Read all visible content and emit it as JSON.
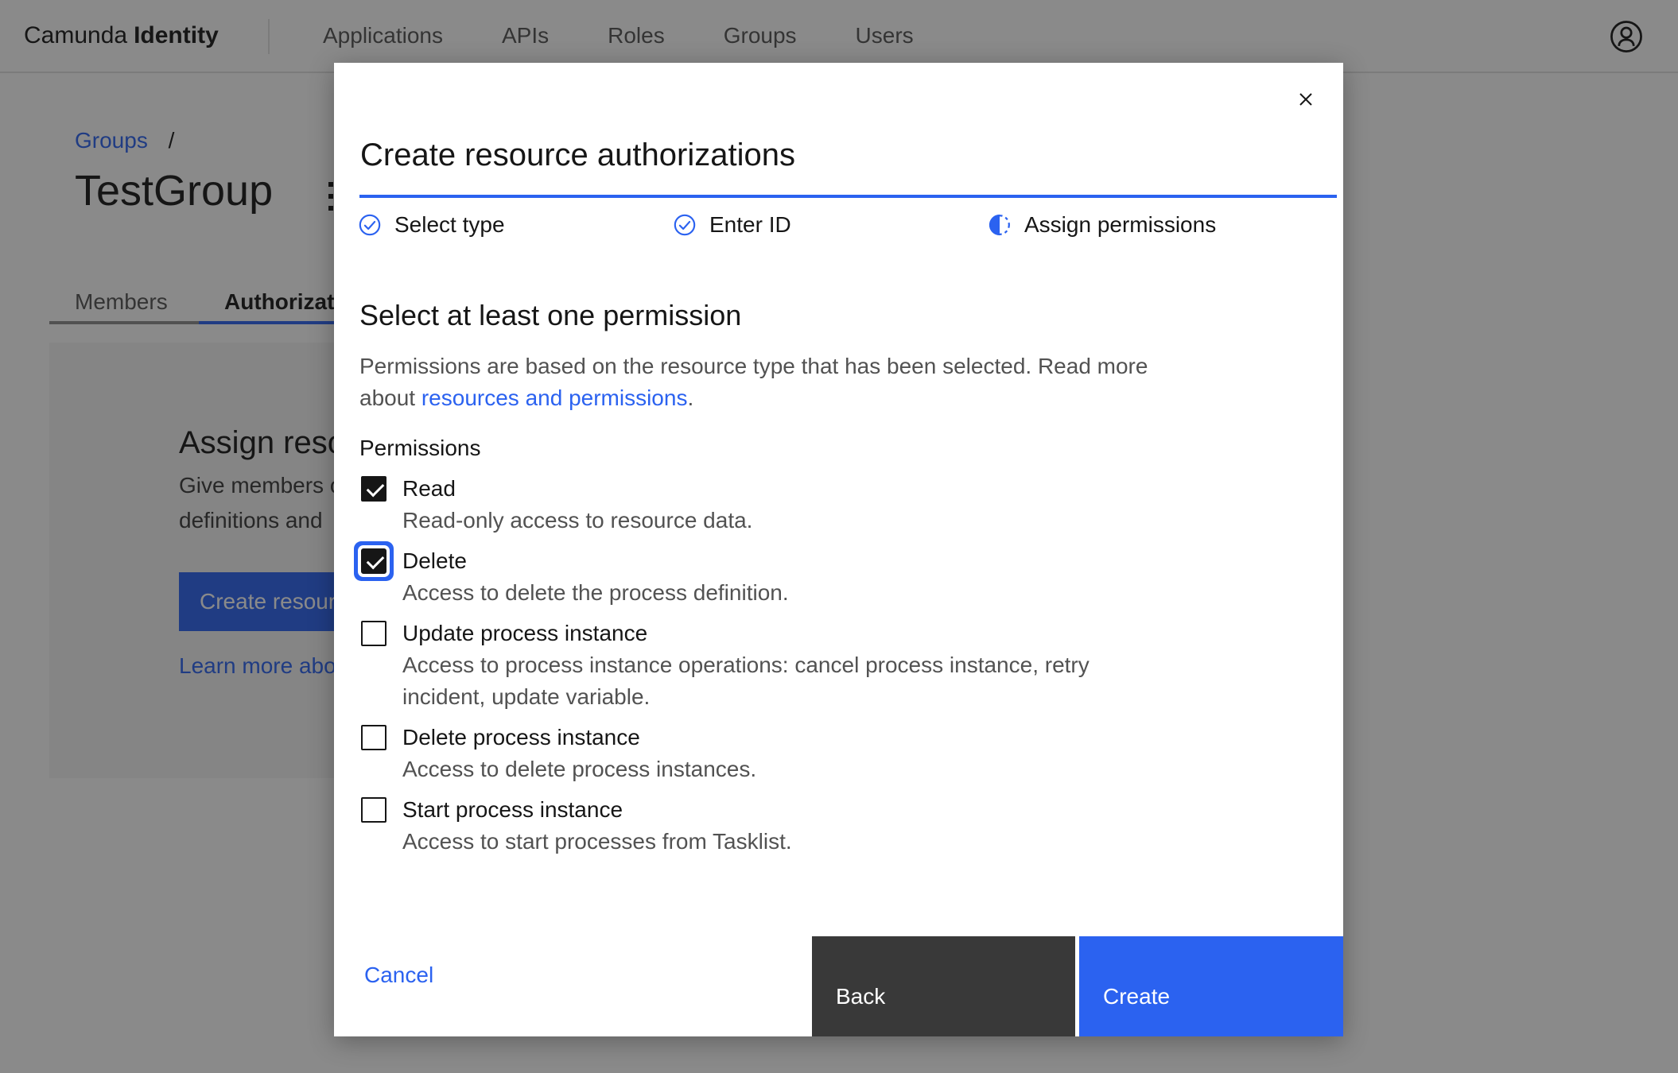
{
  "nav": {
    "brand_name": "Camunda",
    "brand_product": "Identity",
    "items": [
      {
        "label": "Applications"
      },
      {
        "label": "APIs"
      },
      {
        "label": "Roles"
      },
      {
        "label": "Groups"
      },
      {
        "label": "Users"
      }
    ]
  },
  "page": {
    "breadcrumb": {
      "link": "Groups",
      "separator": "/"
    },
    "title": "TestGroup",
    "tabs": [
      {
        "label": "Members",
        "active": false
      },
      {
        "label": "Authorizat",
        "active": true
      }
    ],
    "card": {
      "heading": "Assign reso",
      "line1": "Give members o",
      "line2": "definitions and",
      "button_label": "Create resour",
      "link_label": "Learn more abo"
    }
  },
  "modal": {
    "title": "Create resource authorizations",
    "steps": [
      {
        "label": "Select type",
        "state": "complete"
      },
      {
        "label": "Enter ID",
        "state": "complete"
      },
      {
        "label": "Assign permissions",
        "state": "current"
      }
    ],
    "heading": "Select at least one permission",
    "description_before": "Permissions are based on the resource type that has been selected. Read more about ",
    "description_link": "resources and permissions",
    "description_after": ".",
    "permissions_label": "Permissions",
    "permissions": [
      {
        "label": "Read",
        "description": "Read-only access to resource data.",
        "checked": true,
        "focused": false
      },
      {
        "label": "Delete",
        "description": "Access to delete the process definition.",
        "checked": true,
        "focused": true
      },
      {
        "label": "Update process instance",
        "description": "Access to process instance operations: cancel process instance, retry incident, update variable.",
        "checked": false,
        "focused": false
      },
      {
        "label": "Delete process instance",
        "description": "Access to delete process instances.",
        "checked": false,
        "focused": false
      },
      {
        "label": "Start process instance",
        "description": "Access to start processes from Tasklist.",
        "checked": false,
        "focused": false
      }
    ],
    "footer": {
      "cancel": "Cancel",
      "back": "Back",
      "create": "Create"
    }
  },
  "icons": {
    "close": "close-icon",
    "user": "user-avatar-icon",
    "step_complete": "check-circle-icon",
    "step_current": "half-filled-circle-icon",
    "overflow": "kebab-menu-icon"
  },
  "colors": {
    "primary_blue": "#2b62f0",
    "link_blue": "#2b62f0",
    "dark_button": "#393939",
    "text_primary": "#161616",
    "text_secondary": "#525252",
    "overlay": "rgba(22,22,22,0.5)",
    "card_bg": "#f4f4f4",
    "border": "#e0e0e0"
  }
}
